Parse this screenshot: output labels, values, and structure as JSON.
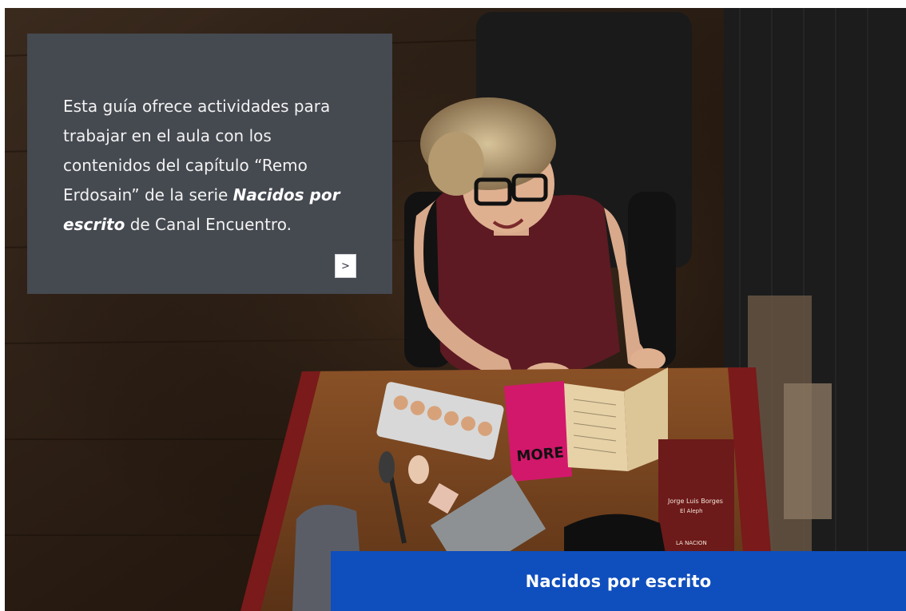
{
  "hero": {
    "photo_alt": "Retrato de la autora sentada en un escritorio con libros",
    "book_cover_text": "Jorge Luis Borges",
    "book_subtitle": "El Aleph",
    "book_publisher": "LA NACION",
    "magazine_text": "MORE"
  },
  "card": {
    "text_before": "Esta guía ofrece actividades para trabajar en el aula con los contenidos del capítulo “Remo Erdosain” de la serie ",
    "series_emphasis": "Nacidos por escrito",
    "text_after": " de Canal Encuentro.",
    "next_label": ">"
  },
  "banner": {
    "title": "Nacidos por escrito"
  },
  "colors": {
    "card_bg": "#454950",
    "banner_bg": "#0f4ebd"
  }
}
